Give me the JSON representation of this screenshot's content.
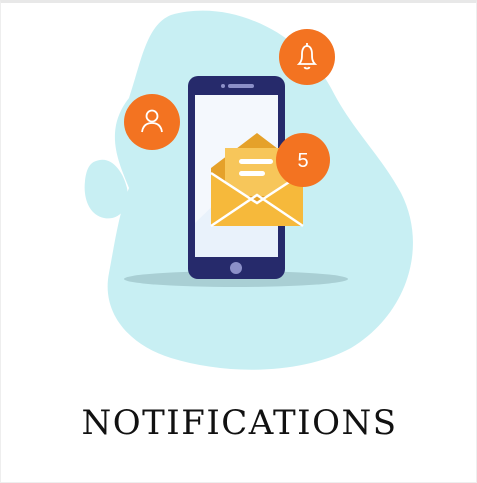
{
  "card": {
    "title": "NOTIFICATIONS"
  },
  "illustration": {
    "message_badge_count": "5",
    "icons": [
      "user-icon",
      "bell-icon",
      "envelope-icon"
    ]
  },
  "colors": {
    "blob": "#c8eff3",
    "phone_body": "#262a6b",
    "screen": "#e9f2fb",
    "envelope": "#f6b93b",
    "envelope_dark": "#e5a12a",
    "badge": "#f37321",
    "shadow": "#a9cfd4"
  }
}
